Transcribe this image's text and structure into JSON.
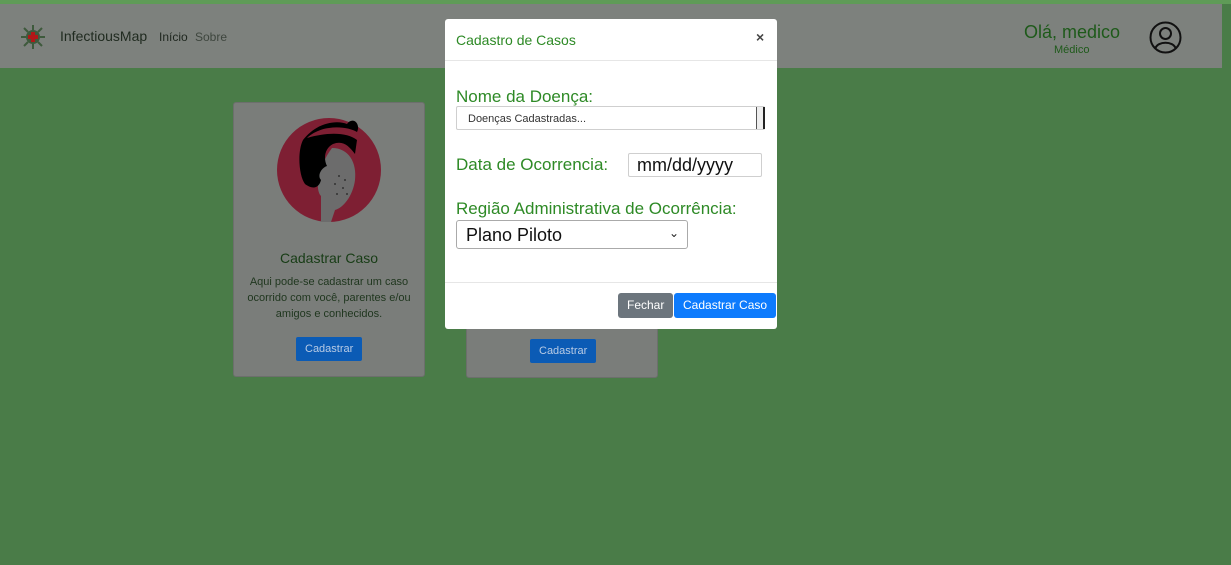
{
  "navbar": {
    "brand": "InfectiousMap",
    "links": [
      {
        "label": "Início"
      },
      {
        "label": "Sobre"
      }
    ],
    "greeting": "Olá, medico",
    "role": "Médico"
  },
  "cards": [
    {
      "title": "Cadastrar Caso",
      "text": "Aqui pode-se cadastrar um caso ocorrido com você, parentes e/ou amigos e conhecidos.",
      "button": "Cadastrar"
    },
    {
      "button": "Cadastrar"
    }
  ],
  "modal": {
    "title": "Cadastro de Casos",
    "close": "×",
    "fields": {
      "doenca_label": "Nome da Doença:",
      "doenca_value": "Doenças Cadastradas...",
      "data_label": "Data de Ocorrencia:",
      "data_value": "mm/dd/yyyy",
      "regiao_label": "Região Administrativa de Ocorrência:",
      "regiao_value": "Plano Piloto"
    },
    "buttons": {
      "close": "Fechar",
      "submit": "Cadastrar Caso"
    }
  },
  "colors": {
    "background": "#4a7c48",
    "accent_green": "#2e8a26",
    "primary": "#0d7bfd"
  }
}
